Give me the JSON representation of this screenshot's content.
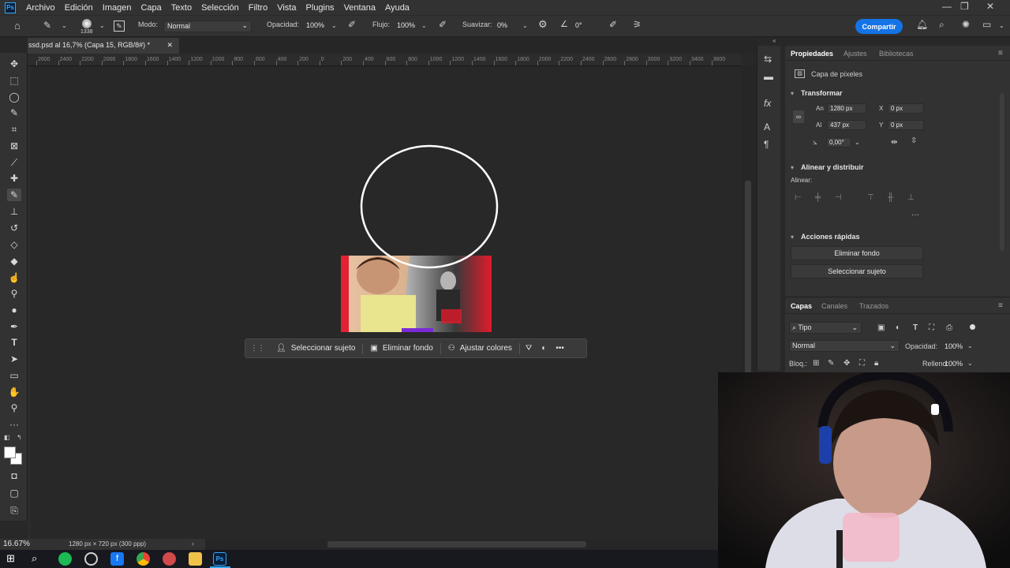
{
  "menubar": {
    "app_badge": "Ps",
    "items": [
      "Archivo",
      "Edición",
      "Imagen",
      "Capa",
      "Texto",
      "Selección",
      "Filtro",
      "Vista",
      "Plugins",
      "Ventana",
      "Ayuda"
    ]
  },
  "options": {
    "brush_size": "1338",
    "mode_label": "Modo:",
    "mode_value": "Normal",
    "opacity_label": "Opacidad:",
    "opacity_value": "100%",
    "flow_label": "Flujo:",
    "flow_value": "100%",
    "smooth_label": "Suavizar:",
    "smooth_value": "0%",
    "angle_value": "0°",
    "share_label": "Compartir"
  },
  "document": {
    "tab_title": "ssd.psd al 16,7% (Capa 15, RGB/8#) *",
    "ruler_ticks": [
      "2600",
      "2400",
      "2200",
      "2000",
      "1800",
      "1600",
      "1400",
      "1200",
      "1000",
      "800",
      "600",
      "400",
      "200",
      "0",
      "200",
      "400",
      "600",
      "800",
      "1000",
      "1200",
      "1400",
      "1600",
      "1800",
      "2000",
      "2200",
      "2400",
      "2600",
      "2800",
      "3000",
      "3200",
      "3400",
      "3600"
    ]
  },
  "context_bar": {
    "select_subject": "Seleccionar sujeto",
    "remove_bg": "Eliminar fondo",
    "adjust_colors": "Ajustar colores"
  },
  "status": {
    "zoom": "16.67%",
    "doc_info": "1280 px × 720 px (300 ppp)"
  },
  "properties": {
    "tabs": [
      "Propiedades",
      "Ajustes",
      "Bibliotecas"
    ],
    "layer_type": "Capa de píxeles",
    "transform_title": "Transformar",
    "w_label": "An",
    "w_value": "1280 px",
    "x_label": "X",
    "x_value": "0 px",
    "h_label": "Al",
    "h_value": "437 px",
    "y_label": "Y",
    "y_value": "0 px",
    "angle_value": "0,00°",
    "align_title": "Alinear y distribuir",
    "align_label": "Alinear:",
    "quick_title": "Acciones rápidas",
    "remove_bg": "Eliminar fondo",
    "select_subject": "Seleccionar sujeto"
  },
  "layers": {
    "tabs": [
      "Capas",
      "Canales",
      "Trazados"
    ],
    "filter_kind": "Tipo",
    "blend_mode": "Normal",
    "opacity_label": "Opacidad:",
    "opacity_value": "100%",
    "lock_label": "Bloq.:",
    "fill_label": "Relleno:",
    "fill_value": "100%"
  },
  "colors": {
    "accent": "#1473e6",
    "ps_blue": "#31a8ff"
  }
}
